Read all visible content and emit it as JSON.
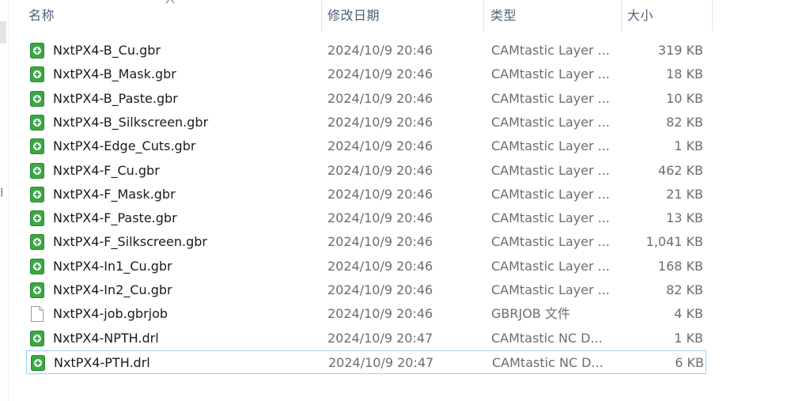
{
  "columns": {
    "name": "名称",
    "date": "修改日期",
    "type": "类型",
    "size": "大小"
  },
  "colors": {
    "header_text": "#4c607a",
    "icon_green": "#3aa845",
    "focus_border": "#99d1ff"
  },
  "files": [
    {
      "name": "NxtPX4-B_Cu.gbr",
      "date": "2024/10/9 20:46",
      "type": "CAMtastic Layer ...",
      "size": "319 KB",
      "icon": "gerber-file-icon"
    },
    {
      "name": "NxtPX4-B_Mask.gbr",
      "date": "2024/10/9 20:46",
      "type": "CAMtastic Layer ...",
      "size": "18 KB",
      "icon": "gerber-file-icon"
    },
    {
      "name": "NxtPX4-B_Paste.gbr",
      "date": "2024/10/9 20:46",
      "type": "CAMtastic Layer ...",
      "size": "10 KB",
      "icon": "gerber-file-icon"
    },
    {
      "name": "NxtPX4-B_Silkscreen.gbr",
      "date": "2024/10/9 20:46",
      "type": "CAMtastic Layer ...",
      "size": "82 KB",
      "icon": "gerber-file-icon"
    },
    {
      "name": "NxtPX4-Edge_Cuts.gbr",
      "date": "2024/10/9 20:46",
      "type": "CAMtastic Layer ...",
      "size": "1 KB",
      "icon": "gerber-file-icon"
    },
    {
      "name": "NxtPX4-F_Cu.gbr",
      "date": "2024/10/9 20:46",
      "type": "CAMtastic Layer ...",
      "size": "462 KB",
      "icon": "gerber-file-icon"
    },
    {
      "name": "NxtPX4-F_Mask.gbr",
      "date": "2024/10/9 20:46",
      "type": "CAMtastic Layer ...",
      "size": "21 KB",
      "icon": "gerber-file-icon"
    },
    {
      "name": "NxtPX4-F_Paste.gbr",
      "date": "2024/10/9 20:46",
      "type": "CAMtastic Layer ...",
      "size": "13 KB",
      "icon": "gerber-file-icon"
    },
    {
      "name": "NxtPX4-F_Silkscreen.gbr",
      "date": "2024/10/9 20:46",
      "type": "CAMtastic Layer ...",
      "size": "1,041 KB",
      "icon": "gerber-file-icon"
    },
    {
      "name": "NxtPX4-In1_Cu.gbr",
      "date": "2024/10/9 20:46",
      "type": "CAMtastic Layer ...",
      "size": "168 KB",
      "icon": "gerber-file-icon"
    },
    {
      "name": "NxtPX4-In2_Cu.gbr",
      "date": "2024/10/9 20:46",
      "type": "CAMtastic Layer ...",
      "size": "82 KB",
      "icon": "gerber-file-icon"
    },
    {
      "name": "NxtPX4-job.gbrjob",
      "date": "2024/10/9 20:46",
      "type": "GBRJOB 文件",
      "size": "4 KB",
      "icon": "blank-file-icon"
    },
    {
      "name": "NxtPX4-NPTH.drl",
      "date": "2024/10/9 20:47",
      "type": "CAMtastic NC D...",
      "size": "1 KB",
      "icon": "gerber-file-icon"
    },
    {
      "name": "NxtPX4-PTH.drl",
      "date": "2024/10/9 20:47",
      "type": "CAMtastic NC D...",
      "size": "6 KB",
      "icon": "gerber-file-icon"
    }
  ]
}
